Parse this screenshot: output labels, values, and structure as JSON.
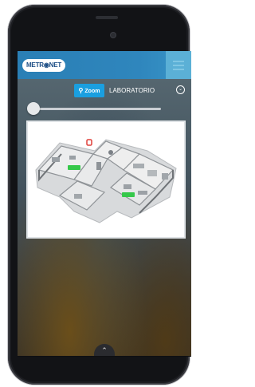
{
  "header": {
    "logo_text": "METR◉NET",
    "menu_icon": "hamburger-menu-icon"
  },
  "toolbar": {
    "zoom_label": "Zoom",
    "zoom_icon": "magnifier-icon",
    "location": "LABORATORIO",
    "location_select_icon": "chevron-down-circle-icon"
  },
  "slider": {
    "value": 0
  },
  "floorplan": {
    "image": "isometric-floor-plan",
    "badges": [
      "",
      ""
    ],
    "marker_icon": "pin-marker-icon"
  },
  "footer": {
    "handle_icon": "chevron-up-icon"
  },
  "colors": {
    "header": "#2f86bd",
    "zoom_button": "#1a9fe0",
    "badge": "#35c84a"
  }
}
